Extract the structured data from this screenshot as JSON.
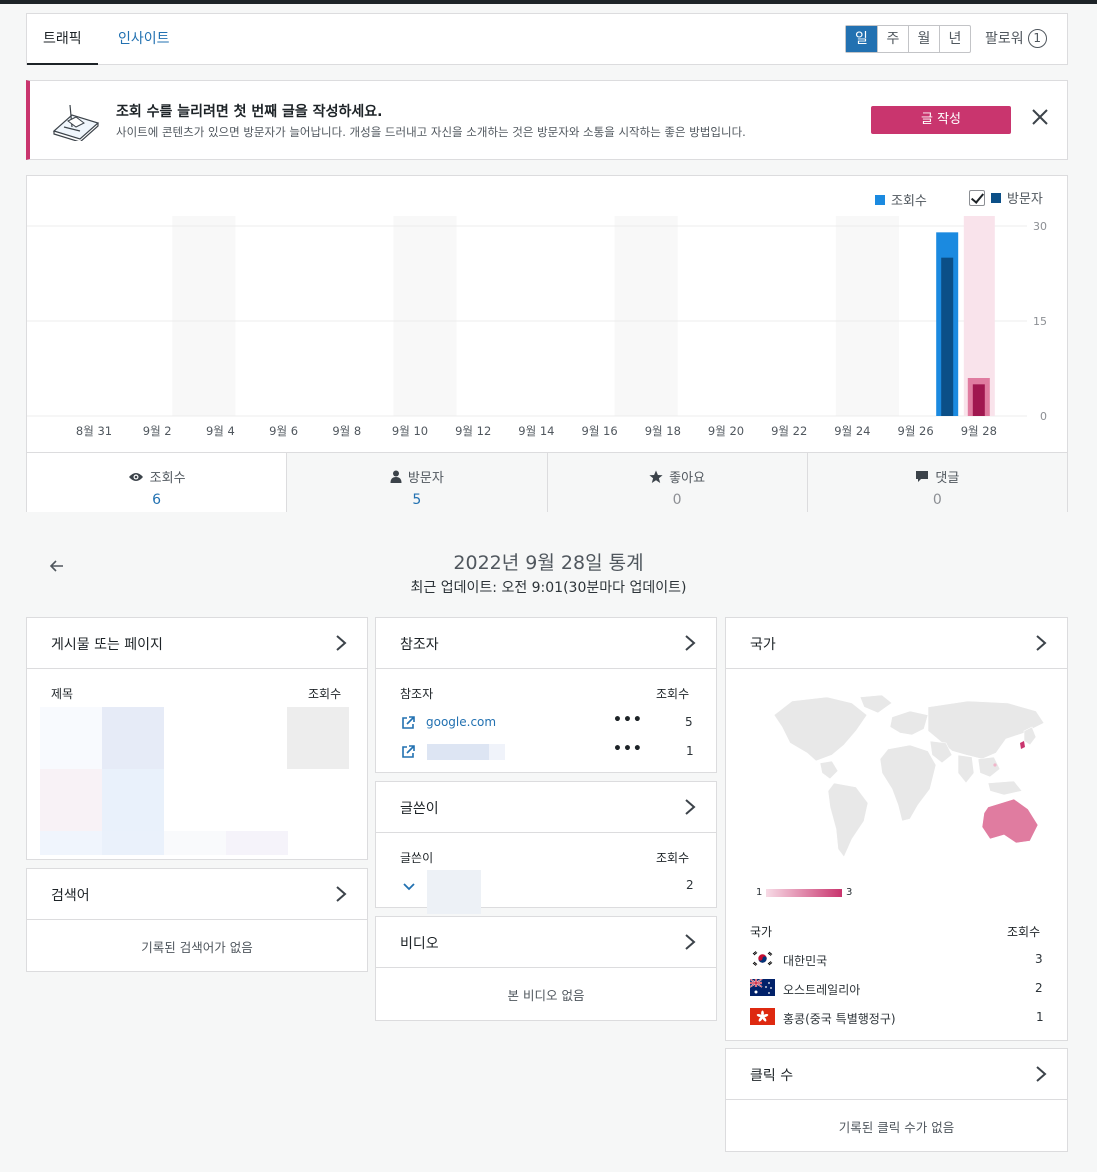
{
  "tabs": {
    "traffic": "트래픽",
    "insights": "인사이트"
  },
  "period": [
    "일",
    "주",
    "월",
    "년"
  ],
  "follow": {
    "label": "팔로워",
    "count": "1"
  },
  "banner": {
    "title": "조회 수를 늘리려면 첫 번째 글을 작성하세요.",
    "text": "사이트에 콘텐츠가 있으면 방문자가 늘어납니다. 개성을 드러내고 자신을 소개하는 것은 방문자와 소통을 시작하는 좋은 방법입니다.",
    "button": "글 작성"
  },
  "legend": {
    "views": "조회수",
    "visitors": "방문자"
  },
  "colors": {
    "views": "#1b8ae0",
    "visitors": "#0b4f87",
    "accent": "#c9356e",
    "link": "#2271b1"
  },
  "chart_data": {
    "type": "bar",
    "categories": [
      "8월 31",
      "9월 1",
      "9월 2",
      "9월 3",
      "9월 4",
      "9월 5",
      "9월 6",
      "9월 7",
      "9월 8",
      "9월 9",
      "9월 10",
      "9월 11",
      "9월 12",
      "9월 13",
      "9월 14",
      "9월 15",
      "9월 16",
      "9월 17",
      "9월 18",
      "9월 19",
      "9월 20",
      "9월 21",
      "9월 22",
      "9월 23",
      "9월 24",
      "9월 25",
      "9월 26",
      "9월 27",
      "9월 28"
    ],
    "tick_labels": [
      "8월 31",
      "9월 2",
      "9월 4",
      "9월 6",
      "9월 8",
      "9월 10",
      "9월 12",
      "9월 14",
      "9월 16",
      "9월 18",
      "9월 20",
      "9월 22",
      "9월 24",
      "9월 26",
      "9월 28"
    ],
    "series": [
      {
        "name": "조회수",
        "values": [
          0,
          0,
          0,
          0,
          0,
          0,
          0,
          0,
          0,
          0,
          0,
          0,
          0,
          0,
          0,
          0,
          0,
          0,
          0,
          0,
          0,
          0,
          0,
          0,
          0,
          0,
          0,
          29,
          6
        ]
      },
      {
        "name": "방문자",
        "values": [
          0,
          0,
          0,
          0,
          0,
          0,
          0,
          0,
          0,
          0,
          0,
          0,
          0,
          0,
          0,
          0,
          0,
          0,
          0,
          0,
          0,
          0,
          0,
          0,
          0,
          0,
          0,
          25,
          5
        ]
      }
    ],
    "yticks": [
      30,
      15,
      0
    ],
    "ylim": [
      0,
      30
    ],
    "selected": "9월 28"
  },
  "stats": [
    {
      "label": "조회수",
      "value": "6",
      "icon": "eye-icon"
    },
    {
      "label": "방문자",
      "value": "5",
      "icon": "person-icon"
    },
    {
      "label": "좋아요",
      "value": "0",
      "icon": "star-icon"
    },
    {
      "label": "댓글",
      "value": "0",
      "icon": "comment-icon"
    }
  ],
  "date": {
    "title": "2022년 9월 28일 통계",
    "sub": "최근 업데이트: 오전 9:01(30분마다 업데이트)"
  },
  "posts": {
    "title": "게시물 또는 페이지",
    "col1": "제목",
    "col2": "조회수"
  },
  "search": {
    "title": "검색어",
    "empty": "기록된 검색어가 없음"
  },
  "referrers": {
    "title": "참조자",
    "col1": "참조자",
    "col2": "조회수",
    "rows": [
      {
        "name": "google.com",
        "value": "5"
      },
      {
        "name": "",
        "value": "1"
      }
    ]
  },
  "authors": {
    "title": "글쓴이",
    "col1": "글쓴이",
    "col2": "조회수",
    "rows": [
      {
        "value": "2"
      }
    ]
  },
  "videos": {
    "title": "비디오",
    "empty": "본 비디오 없음"
  },
  "countries": {
    "title": "국가",
    "col1": "국가",
    "col2": "조회수",
    "scale_min": "1",
    "scale_max": "3",
    "rows": [
      {
        "name": "대한민국",
        "value": "3"
      },
      {
        "name": "오스트레일리아",
        "value": "2"
      },
      {
        "name": "홍콩(중국 특별행정구)",
        "value": "1"
      }
    ]
  },
  "clicks": {
    "title": "클릭 수",
    "empty": "기록된 클릭 수가 없음"
  }
}
